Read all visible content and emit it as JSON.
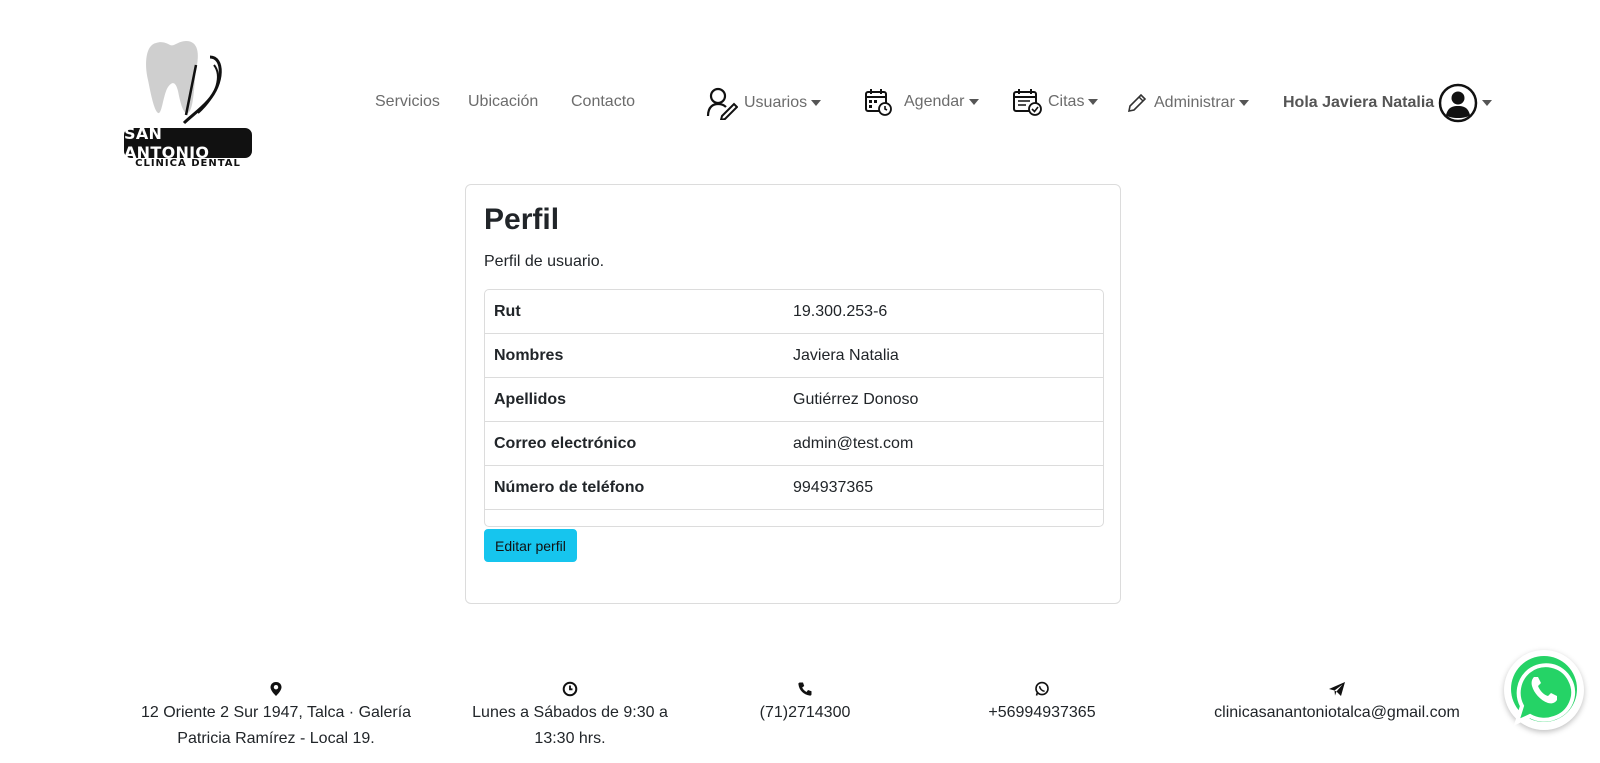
{
  "brand": {
    "name": "SAN ANTONIO",
    "subtitle": "CLINICA DENTAL"
  },
  "nav": {
    "servicios": "Servicios",
    "ubicacion": "Ubicación",
    "contacto": "Contacto",
    "usuarios": "Usuarios",
    "agendar": "Agendar",
    "citas": "Citas",
    "administrar": "Administrar",
    "greeting": "Hola Javiera Natalia"
  },
  "profile": {
    "title": "Perfil",
    "subtitle": "Perfil de usuario.",
    "rows": [
      {
        "label": "Rut",
        "value": "19.300.253-6"
      },
      {
        "label": "Nombres",
        "value": "Javiera Natalia"
      },
      {
        "label": "Apellidos",
        "value": "Gutiérrez Donoso"
      },
      {
        "label": "Correo electrónico",
        "value": "admin@test.com"
      },
      {
        "label": "Número de teléfono",
        "value": "994937365"
      }
    ],
    "edit_label": "Editar perfil"
  },
  "footer": {
    "address_line1": "12 Oriente 2 Sur 1947, Talca · Galería",
    "address_line2": "Patricia Ramírez - Local 19.",
    "hours_line1": "Lunes a Sábados de 9:30 a",
    "hours_line2": "13:30 hrs.",
    "phone": "(71)2714300",
    "whatsapp": "+56994937365",
    "email": "clinicasanantoniotalca@gmail.com"
  },
  "colors": {
    "accent": "#16c5ee",
    "whatsapp_green": "#25d366"
  }
}
